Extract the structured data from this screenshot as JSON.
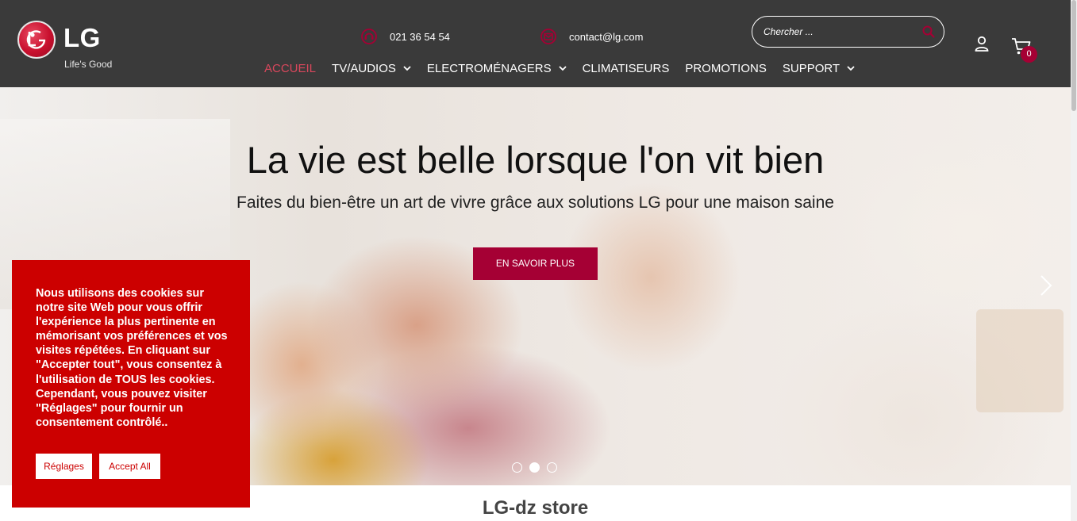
{
  "header": {
    "logo_text": "LG",
    "logo_tagline": "Life's Good",
    "phone": "021 36 54 54",
    "email": "contact@lg.com",
    "search_placeholder": "Chercher ...",
    "cart_count": "0",
    "colors": {
      "header_bg": "#3a3a3a",
      "brand": "#a50034",
      "active_nav": "#d9475c"
    },
    "icons": {
      "phone": "headset-icon",
      "email": "envelope-icon",
      "search": "magnifier-icon",
      "user": "user-icon",
      "cart": "cart-icon"
    }
  },
  "nav": {
    "items": [
      {
        "label": "ACCUEIL",
        "active": true,
        "dropdown": false
      },
      {
        "label": "TV/AUDIOS",
        "active": false,
        "dropdown": true
      },
      {
        "label": "ELECTROMÉNAGERS",
        "active": false,
        "dropdown": true
      },
      {
        "label": "CLIMATISEURS",
        "active": false,
        "dropdown": false
      },
      {
        "label": "PROMOTIONS",
        "active": false,
        "dropdown": false
      },
      {
        "label": "SUPPORT",
        "active": false,
        "dropdown": true
      }
    ]
  },
  "hero": {
    "title": "La vie est belle lorsque l'on vit bien",
    "subtitle": "Faites du bien-être un art de vivre grâce aux solutions LG pour une maison saine",
    "cta_label": "EN SAVOIR PLUS",
    "slide_count": 3,
    "active_slide": 2
  },
  "store": {
    "title": "LG-dz store"
  },
  "cookie": {
    "message": "Nous utilisons des cookies sur notre site Web pour vous offrir l'expérience la plus pertinente en mémorisant vos préférences et vos visites répétées. En cliquant sur \"Accepter tout\", vous consentez à l'utilisation de TOUS les cookies. Cependant, vous pouvez visiter \"Réglages\" pour fournir un consentement contrôlé..",
    "settings_label": "Réglages",
    "accept_label": "Accept All",
    "color": "#cc0000"
  }
}
